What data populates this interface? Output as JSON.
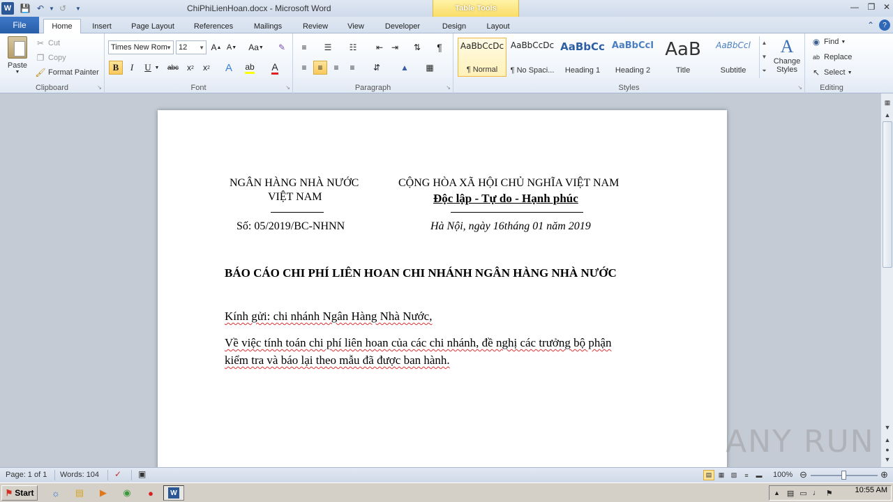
{
  "window": {
    "title": "ChiPhiLienHoan.docx - Microsoft Word",
    "context_tab_group": "Table Tools"
  },
  "tabs": [
    "File",
    "Home",
    "Insert",
    "Page Layout",
    "References",
    "Mailings",
    "Review",
    "View",
    "Developer",
    "Design",
    "Layout"
  ],
  "active_tab": "Home",
  "ribbon": {
    "clipboard": {
      "label": "Clipboard",
      "paste": "Paste",
      "cut": "Cut",
      "copy": "Copy",
      "format_painter": "Format Painter"
    },
    "font": {
      "label": "Font",
      "font_name": "Times New Rom",
      "font_size": "12"
    },
    "paragraph": {
      "label": "Paragraph"
    },
    "styles": {
      "label": "Styles",
      "items": [
        {
          "sample": "AaBbCcDc",
          "name": "¶ Normal",
          "selected": true
        },
        {
          "sample": "AaBbCcDc",
          "name": "¶ No Spaci...",
          "selected": false
        },
        {
          "sample": "AaBbCc",
          "name": "Heading 1",
          "selected": false
        },
        {
          "sample": "AaBbCcI",
          "name": "Heading 2",
          "selected": false
        },
        {
          "sample": "AaB",
          "name": "Title",
          "selected": false
        },
        {
          "sample": "AaBbCcl",
          "name": "Subtitle",
          "selected": false
        }
      ],
      "change_styles": "Change Styles"
    },
    "editing": {
      "label": "Editing",
      "find": "Find",
      "replace": "Replace",
      "select": "Select"
    }
  },
  "document": {
    "left_header_line1": "NGÂN HÀNG NHÀ NƯỚC",
    "left_header_line2": "VIỆT NAM",
    "left_number": "Số: 05/2019/BC-NHNN",
    "right_header_line1": "CỘNG HÒA XÃ HỘI CHỦ NGHĨA VIỆT NAM",
    "right_header_line2": "Độc lập - Tự do - Hạnh phúc",
    "right_date": "Hà Nội, ngày 16tháng 01  năm 2019",
    "title": "BÁO CÁO CHI PHÍ LIÊN HOAN CHI NHÁNH NGÂN HÀNG NHÀ NƯỚC",
    "salutation": "Kính gửi:  chi nhánh Ngân Hàng Nhà Nước,",
    "body_line1": "Về việc tính toán chi phí liên hoan của các chi nhánh, đề nghị các trưởng bộ phận",
    "body_line2": "kiểm tra và báo lại theo mẫu đã được ban hành."
  },
  "status_bar": {
    "page": "Page: 1 of 1",
    "words": "Words: 104",
    "zoom": "100%"
  },
  "taskbar": {
    "start": "Start",
    "clock": "10:55 AM"
  },
  "watermark": "ANY RUN",
  "colors": {
    "file_tab": "#2f68b5",
    "selected_style_border": "#f0b740",
    "context_tab": "#f8d85a"
  }
}
